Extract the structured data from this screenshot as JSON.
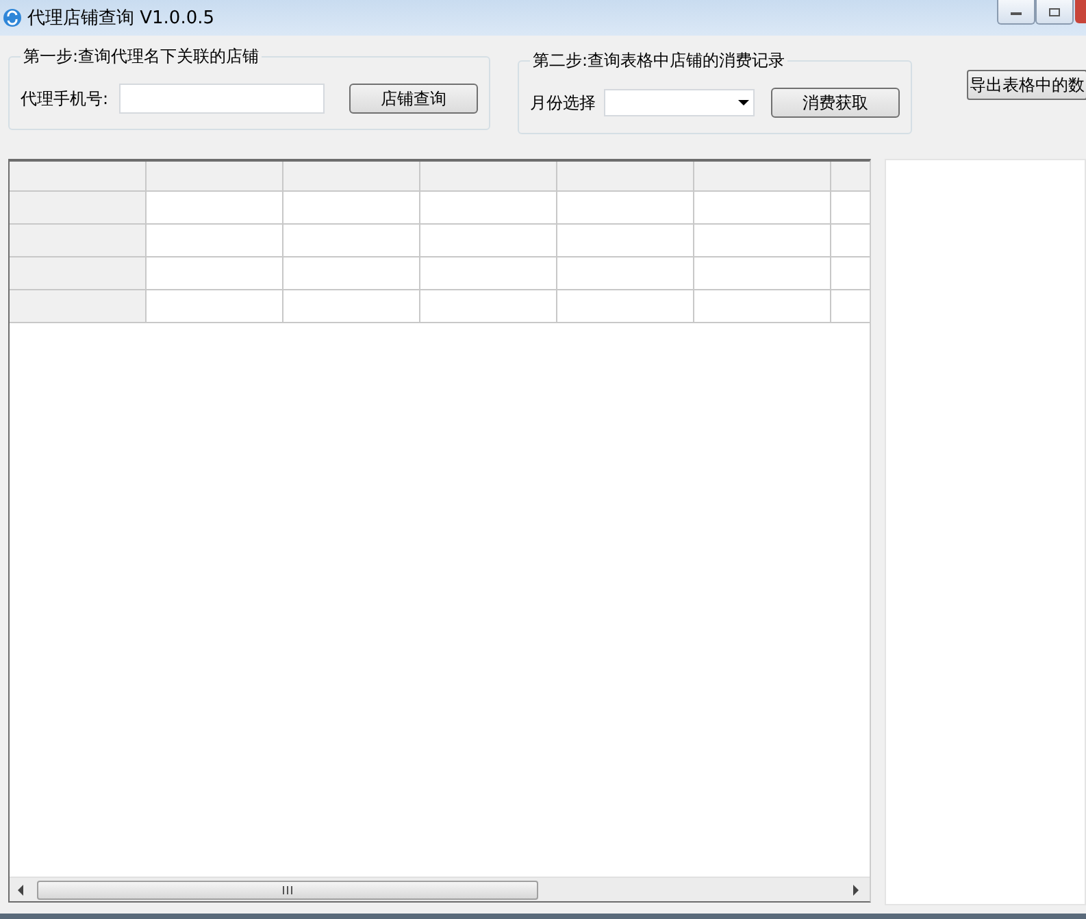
{
  "window": {
    "title": "代理店铺查询 V1.0.0.5"
  },
  "step1": {
    "legend": "第一步:查询代理名下关联的店铺",
    "label": "代理手机号:",
    "button": "店铺查询"
  },
  "step2": {
    "legend": "第二步:查询表格中店铺的消费记录",
    "label": "月份选择",
    "button": "消费获取"
  },
  "export_button": "导出表格中的数"
}
